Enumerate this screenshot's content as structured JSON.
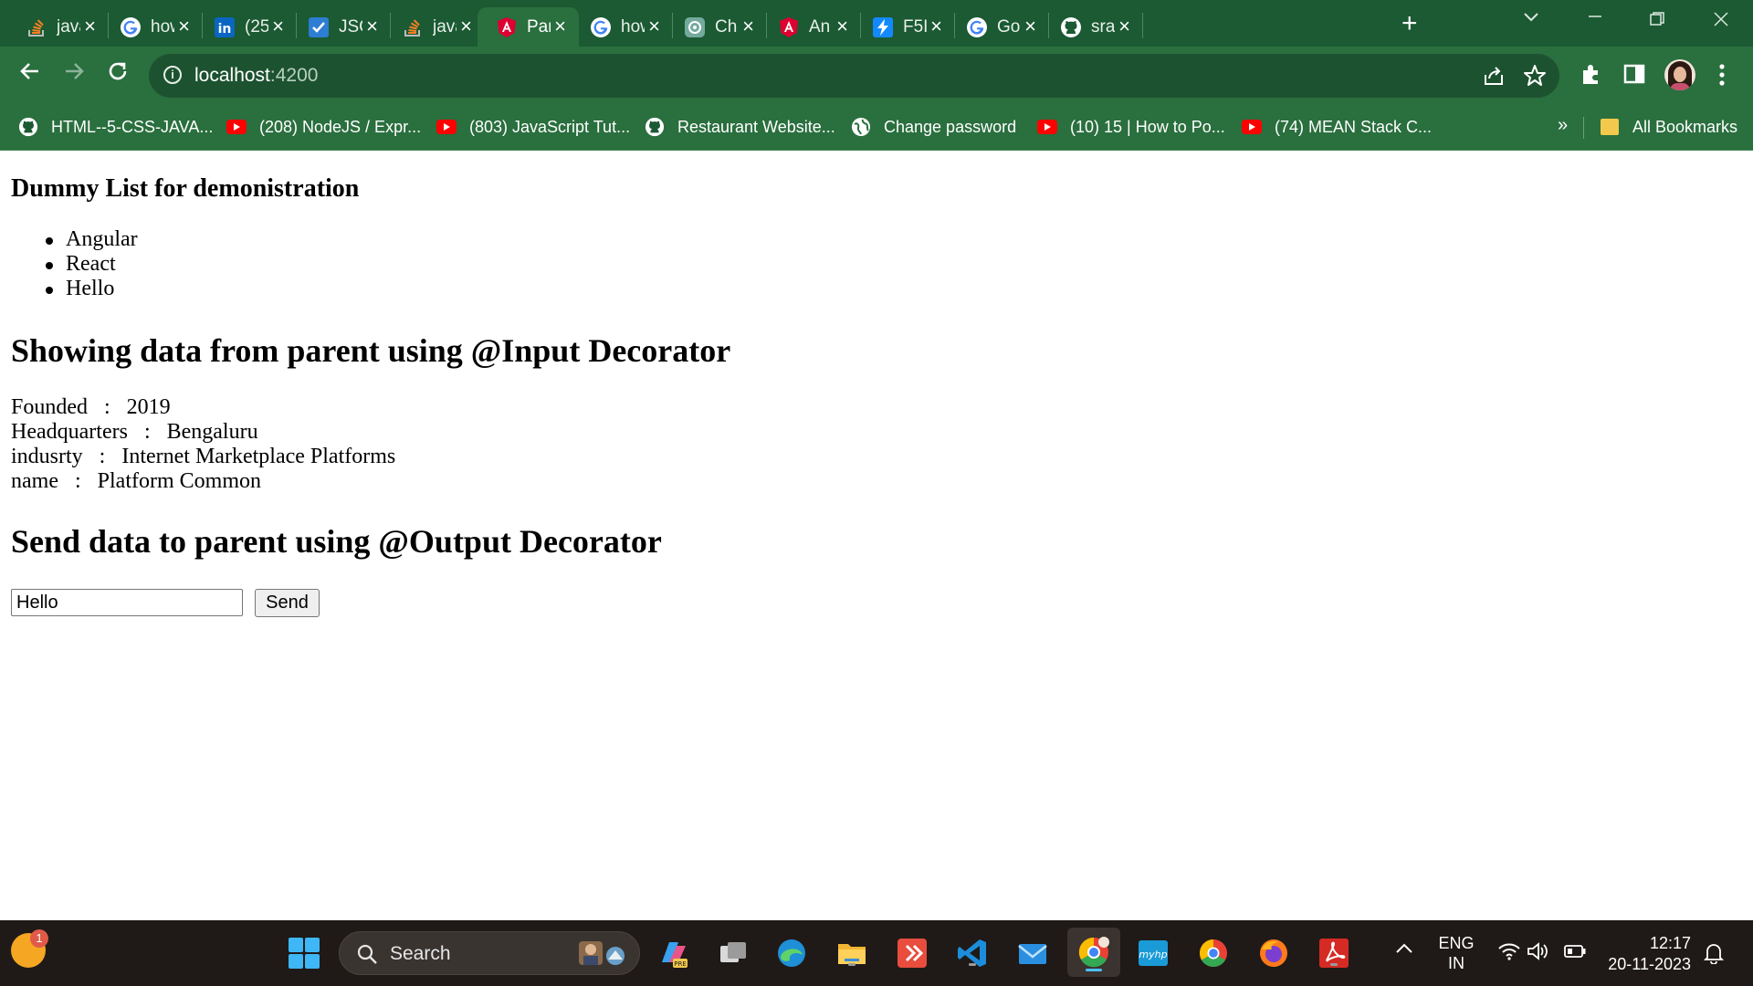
{
  "browser": {
    "tabs": [
      {
        "label": "java",
        "icon": "stackoverflow-icon",
        "active": false
      },
      {
        "label": "how",
        "icon": "google-icon",
        "active": false
      },
      {
        "label": "(25",
        "icon": "linkedin-icon",
        "active": false
      },
      {
        "label": "JSC",
        "icon": "checkbox-icon",
        "active": false
      },
      {
        "label": "java",
        "icon": "stackoverflow-icon",
        "active": false
      },
      {
        "label": "Par",
        "icon": "angular-icon",
        "active": true
      },
      {
        "label": "how",
        "icon": "google-icon",
        "active": false
      },
      {
        "label": "Ch",
        "icon": "chatgpt-icon",
        "active": false
      },
      {
        "label": "An",
        "icon": "angular-icon",
        "active": false
      },
      {
        "label": "F5I",
        "icon": "bolt-icon",
        "active": false
      },
      {
        "label": "Go",
        "icon": "google-icon",
        "active": false
      },
      {
        "label": "sra",
        "icon": "github-icon",
        "active": false
      }
    ],
    "url": {
      "host": "localhost",
      "port": ":4200"
    },
    "bookmarks": [
      {
        "label": "HTML--5-CSS-JAVA...",
        "icon": "github-icon"
      },
      {
        "label": "(208) NodeJS / Expr...",
        "icon": "youtube-icon"
      },
      {
        "label": "(803) JavaScript Tut...",
        "icon": "youtube-icon"
      },
      {
        "label": "Restaurant Website...",
        "icon": "github-icon"
      },
      {
        "label": "Change password",
        "icon": "globe-icon"
      },
      {
        "label": "(10) 15 | How to Po...",
        "icon": "youtube-icon"
      },
      {
        "label": "(74) MEAN Stack C...",
        "icon": "youtube-icon"
      }
    ],
    "all_bookmarks_label": "All Bookmarks",
    "overflow_label": "»"
  },
  "page": {
    "list_title": "Dummy List for demonistration",
    "list_items": [
      "Angular",
      "React",
      "Hello"
    ],
    "input_section_title": "Showing data from parent using @Input Decorator",
    "details": [
      {
        "key": "Founded",
        "sep": ":",
        "value": "2019"
      },
      {
        "key": "Headquarters",
        "sep": ":",
        "value": "Bengaluru"
      },
      {
        "key": "indusrty",
        "sep": ":",
        "value": "Internet Marketplace Platforms"
      },
      {
        "key": "name",
        "sep": ":",
        "value": "Platform Common"
      }
    ],
    "output_section_title": "Send data to parent using @Output Decorator",
    "send_input_value": "Hello",
    "send_button_label": "Send"
  },
  "taskbar": {
    "search_label": "Search",
    "weather_badge": "1",
    "language": "ENG",
    "region": "IN",
    "time": "12:17",
    "date": "20-11-2023"
  }
}
